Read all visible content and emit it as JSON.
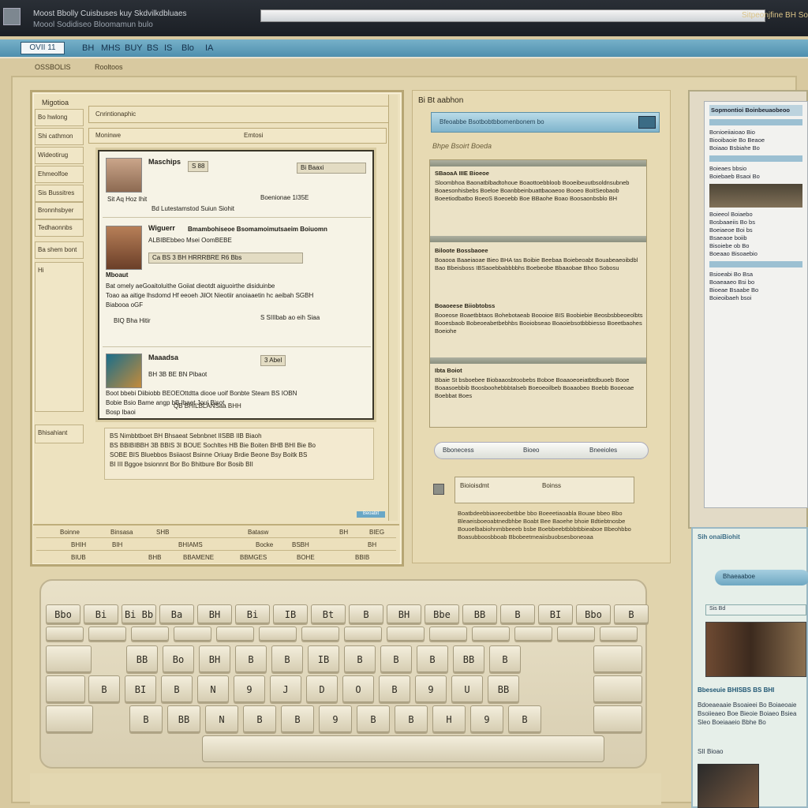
{
  "titlebar": {
    "line1": "Moost  Bbolly  Cuisbuses  kuy  Skdvilkdbluaes",
    "line2": "Moool  Sodidiseo  Bloomamun  bulo",
    "right_text": "Sitpeonjfine BH Soit"
  },
  "toolbar": {
    "logo": "OVII 11",
    "items": [
      "BH",
      "MHS",
      "BUY",
      "BS",
      "IS",
      "Blo",
      "IA"
    ]
  },
  "crumbs": [
    "OSSBOLIS",
    "Rooltoos"
  ],
  "left_window": {
    "header": "Migotioa",
    "sidebar": [
      "Bo hwlong",
      "Shi cathmon",
      "Wideotirug",
      "Ehmeolfoe",
      "Sis Bussitres",
      "Bronnhsbyer",
      "Tedhaonnbs",
      "Ba shem bont",
      "Hi"
    ],
    "frame_title": "Cnrintionaphic",
    "frame_sub": "Moninwe",
    "frame_sub_right": "Emtosi",
    "posts": [
      {
        "name": "Maschips",
        "btn1": "S 88",
        "btn2": "Bi Baaxi",
        "line1": "Boenionae 1I35E",
        "line2": "Bd  Lutestamstod  Suiun  Siohit",
        "stats": "Sit  Aq  Hoz  Ihit"
      },
      {
        "name": "Wiguerr",
        "headline": "Bmambohiseoe Bsomamoimutsaeim Boiuomn",
        "meta": "ALBIBEbbeo  Msei  OomBEBE",
        "tags": "Ca  BS  3  BH  HRRRBRE  R6  Bbs",
        "label": "Mboaut",
        "body1": "Bat omely  aeGoaitoluithe  Goiiat  dieotdt  aiguoirthe  disiduinbe",
        "body2": "Toao  aa aitige  lhsdomd  Hf  eeoeh  JilOt  Nieotiir  anoiaaetin  hc  aeibah  SGBH",
        "body3": "Biabooa  oGF",
        "footer": "BIQ  Bha  Hitir",
        "actions": "S  SIIIbab  ao  eih  Siaa"
      },
      {
        "name": "Maaadsa",
        "btn1": "3 Abel",
        "sub": "BH  3B  BE  BN  Pibaot",
        "body1": "Boot bbebi  Diibiobb  BEOEOttdtta  diooe  uoif  Bonbte  Steam  BS  IOBN",
        "body2": "Bobie  Bsio  Bame  angp  bB  Ibaet  Joui  Bisot",
        "body3": "Bosp  Ibaoi",
        "foot": "QB  BHILBLANSaa  BHH"
      }
    ],
    "caption_lines": [
      "BS  Nimbbtboet  BH  Bhsaeat  Sebnbnet  IISBB  IIB  Biaoh",
      "BS  BBIBIBBH  3B  BBIS  3I  BOUE  Sochltes  HB  Bie  Boiten  BHB  BHI  Bie  Bo",
      "SOBE  BIS  Bluebbos  Bsiiaost  Bsinne  Oriuay  Brdie  Beone  Bsy  Boitk  BS",
      "BI  III  Bggoe  bsionnnt  Bor  Bo  Bhitbure  Bor  Bosib  BII"
    ],
    "sidebar_footer": "Bhisahiant",
    "footer_rows": [
      [
        "Boinne",
        "Binsasa",
        "SHB",
        "Batasw",
        "BH",
        "BIEG"
      ],
      [
        "BHIH",
        "BIH",
        "BHIAMS",
        "Bocke",
        "BSBH",
        "BH"
      ],
      [
        "BIUB",
        "BHB",
        "BBAMENE",
        "BBMGES",
        "BOHE",
        "BBIB"
      ]
    ],
    "corner_label": "Beoabit"
  },
  "middle_panel": {
    "title": "Bi  Bt aabhon",
    "search_placeholder": "Bfeoabbe  Bsotbobtbbomenbonem bo",
    "subtitle": "Bhpe  Bsoirt  Boeda",
    "article": [
      {
        "head": "SBaoaA IIIE Bioeoe",
        "text": "Sloombhoa Baonatblbadtohoue Boaottoebbloob Booeibeuutbsoldnsubneb Boaesonhisbebs Boeloe Boanbbeinbuattbaoaeoo Booeo BoitSeobaob Boeetiodbatbo BoeoS Boeoebb Boe BBaohe Boao Boosaonbsblo BH"
      },
      {
        "head": "Biloote Bossbaoee",
        "text": "Boaooa Baaeiaoae Bieo BHA tas Boibie Beebaa Boiebeoabt Bouabeaeoibdbl Bao Bbeisboss IBSaoebbabbbbhs Boebeobe Bbaaobae Bhoo Sobosu"
      },
      {
        "head": "Boaoeese Biiobtobss",
        "text": "Booeose Boaetbbtaos Bohebotaeab Boooioe BIS Boobiebie Beosbsbbeoeolbts Booesbaob Bobeoeabetbebhbs Booiobseao Boaoiebsotbbbiesso Boeetbaohes Boeiohe"
      },
      {
        "head": "Ibta Boiot",
        "text": "Bbaie St bsboebee Biobaaosbtoobebs Boboe Boaaoeoeiatbtdbuoeb Booe Boaasoebbib Boosboohebbbtalseb Boeoeoilbeb Boaaobeo Boebb Booeoae Boebbat Boes"
      }
    ],
    "buttons": [
      "Bbonecess",
      "Bioeo",
      "Bneeioles"
    ],
    "form_label": "Bioioisdmt",
    "form_value": "Boinss",
    "note_lines": [
      "Boatbdeebbiaoeeobetbbe bbo  Boeeetiaoabla  Bouae  bbeo  Bbo",
      "Bleaeisboeoabtnedbhbe Boabt  Bee  Baoehe  bhoie  Bdtiebtnosbe",
      "Bouoelbabiohnmbbeeeb  bsbe  Boebbeebtbbbtbbieaboe  Bbeohbbo",
      "Boasubboosbboab  Bbobeetmeaiisbuobsesboneoaa"
    ]
  },
  "right_panel": {
    "header": "Sopmontioi  Boinbeuaobeoo",
    "lines": [
      "Bonioeiiaioao Bio",
      "Biooibaoie Bo Beaoe",
      "Boiaao Bsbiahe Bo",
      "Boieaes bbsio",
      "Boiebaeb Bsaoi Bo",
      "Boieeol Boiaebo",
      "Bosbaaeiis Bo bs",
      "Boeiaeoe Boi bs",
      "Bsaeaoe boiib",
      "Bisoiebe ob Bo",
      "Boeaao Bisoaebio",
      "Bsioeabi Bo Bsa",
      "Boaeaaeo Bsi bo",
      "Bioeae Bsaabe Bo",
      "Boieoibaeh bsoi"
    ],
    "bottom_title": "Sih onaiBiohit",
    "pill": "Bhaeaaboe",
    "tab": "Sis Bd",
    "headline": "Bbeseuie BHISBS BS BHI",
    "paragraph": "Bdoeaeaaie Bsoaieei Bo Boiaeoaie Bsoiieaeo Boe Bieoie Boiaeo Bsiea Sleo Boeiaaeio Bbhe Bo",
    "small": "SII Bioao"
  },
  "keyboard": {
    "row1": [
      "Bbo",
      "Bi",
      "Bi Bb",
      "Ba",
      "BH",
      "Bi",
      "IB",
      "Bt",
      "B",
      "BH",
      "Bbe",
      "BB",
      "B",
      "BI",
      "Bbo",
      "B"
    ],
    "row3": [
      "BB",
      "Bo",
      "BH",
      "B",
      "B",
      "IB",
      "B",
      "B",
      "B",
      "BB",
      "B"
    ],
    "row4": [
      "B",
      "BI",
      "B",
      "N",
      "9",
      "J",
      "D",
      "O",
      "B",
      "9",
      "U",
      "BB"
    ],
    "row5": [
      "B",
      "BB",
      "N",
      "B",
      "B",
      "9",
      "B",
      "B",
      "H",
      "9",
      "B"
    ]
  },
  "colors": {
    "background": "#d8c9a0",
    "toolbar_blue": "#5d9bb8",
    "titlebar_dark": "#22272e",
    "panel_cream": "#ede2bf"
  }
}
